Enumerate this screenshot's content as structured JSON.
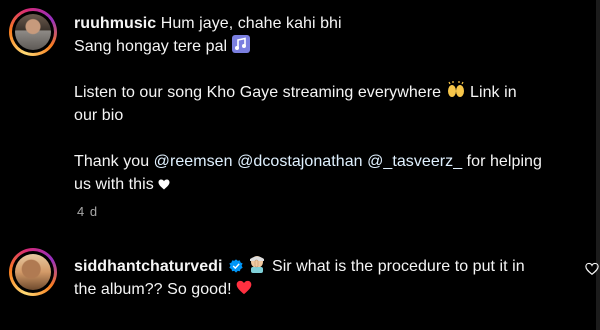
{
  "comment1": {
    "username": "ruuhmusic",
    "line1_text": "Hum jaye, chahe kahi bhi",
    "line2_text": "Sang hongay tere pal",
    "line3_text": "Listen to our song Kho Gaye streaming everywhere",
    "line3_tail": "Link in",
    "line4_text": "our bio",
    "line5_prefix": "Thank you",
    "mention1": "@reemsen",
    "mention2": "@dcostajonathan",
    "mention3": "@_tasveerz_",
    "line5_suffix": "for helping",
    "line6_text": "us with this",
    "timestamp": "4 d",
    "icons": [
      "music-note-icon",
      "raised-hands-icon",
      "white-heart-icon"
    ]
  },
  "comment2": {
    "username": "siddhantchaturvedi",
    "verified": true,
    "line1_text": "Sir what is the procedure to put it in",
    "line2_text": "the album?? So good!",
    "icons": [
      "verified-badge-icon",
      "facepalm-icon",
      "red-heart-icon",
      "like-heart-icon"
    ]
  },
  "colors": {
    "background": "#000000",
    "text": "#f5f5f5",
    "secondary_text": "#a8a8a8",
    "mention": "#e0f1ff",
    "verified": "#0095f6",
    "red_heart": "#ff3040"
  }
}
